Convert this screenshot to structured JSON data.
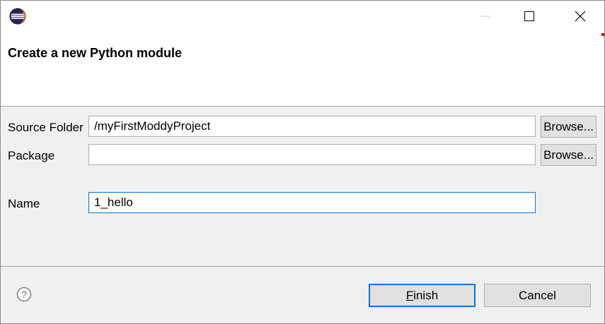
{
  "dialog": {
    "title": "Create a new Python module"
  },
  "form": {
    "source_folder": {
      "label": "Source Folder",
      "value": "/myFirstModdyProject",
      "browse_label": "Browse..."
    },
    "package": {
      "label": "Package",
      "value": "",
      "browse_label": "Browse..."
    },
    "name": {
      "label": "Name",
      "value": "1_hello"
    }
  },
  "footer": {
    "finish_mnemonic": "F",
    "finish_rest": "inish",
    "cancel_label": "Cancel"
  },
  "icons": {
    "app": "eclipse-icon",
    "minimize": "minimize-icon",
    "maximize": "maximize-icon",
    "close": "close-icon",
    "help": "help-icon"
  },
  "colors": {
    "accent": "#0078d7",
    "button_bg": "#e1e1e1",
    "dialog_bg": "#f0f0f0"
  }
}
